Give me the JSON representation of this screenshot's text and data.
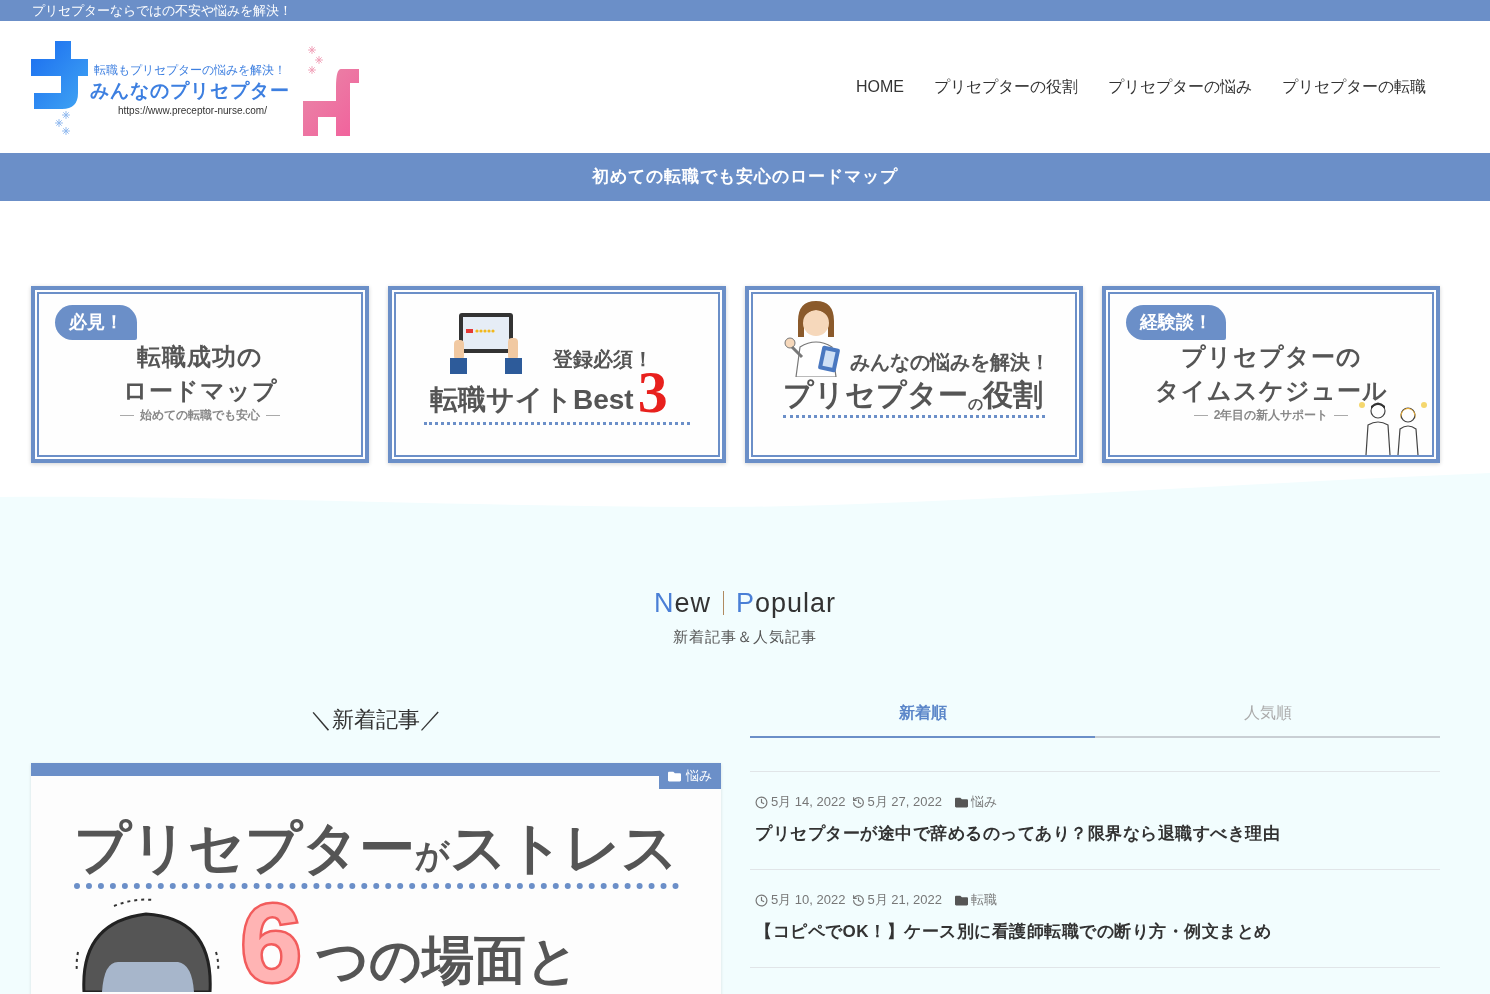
{
  "top_bar": {
    "text": "プリセプターならではの不安や悩みを解決！"
  },
  "header": {
    "logo": {
      "tagline": "転職もプリセプターの悩みを解決！",
      "name": "みんなのプリセプター",
      "url": "https://www.preceptor-nurse.com/"
    },
    "nav": [
      {
        "label": "HOME"
      },
      {
        "label": "プリセプターの役割"
      },
      {
        "label": "プリセプターの悩み"
      },
      {
        "label": "プリセプターの転職"
      }
    ]
  },
  "banner": {
    "text": "初めての転職でも安心のロードマップ"
  },
  "cards": [
    {
      "kind": "roadmap",
      "bubble": "必見！",
      "lines": [
        "転職成功の",
        "ロードマップ"
      ],
      "caption": "始めての転職でも安心"
    },
    {
      "kind": "ranking",
      "kicker": "登録必須！",
      "title": "転職サイトBest",
      "number": "3"
    },
    {
      "kind": "role",
      "kicker": "みんなの悩みを解決！",
      "title": "プリセプター$_{の}$役割"
    },
    {
      "kind": "schedule",
      "bubble": "経験談！",
      "lines": [
        "プリセプターの",
        "タイムスケジュール"
      ],
      "caption": "2年目の新人サポート"
    }
  ],
  "section": {
    "title_left": "New",
    "title_right": "Popular",
    "subtitle": "新着記事＆人気記事"
  },
  "new_posts": {
    "heading": "＼新着記事／",
    "featured": {
      "category": "悩み",
      "image_title": "プリセプター$_{が}$ストレス",
      "image_number": "6",
      "image_subtitle": "つの場面と"
    }
  },
  "article_list": {
    "tabs": [
      {
        "label": "新着順",
        "selected": true
      },
      {
        "label": "人気順",
        "selected": false
      }
    ],
    "posts": [
      {
        "published": "5月 14, 2022",
        "updated": "5月 27, 2022",
        "category": "悩み",
        "title": "プリセプターが途中で辞めるのってあり？限界なら退職すべき理由"
      },
      {
        "published": "5月 10, 2022",
        "updated": "5月 21, 2022",
        "category": "転職",
        "title": "【コピペでOK！】ケース別に看護師転職での断り方・例文まとめ"
      }
    ]
  }
}
